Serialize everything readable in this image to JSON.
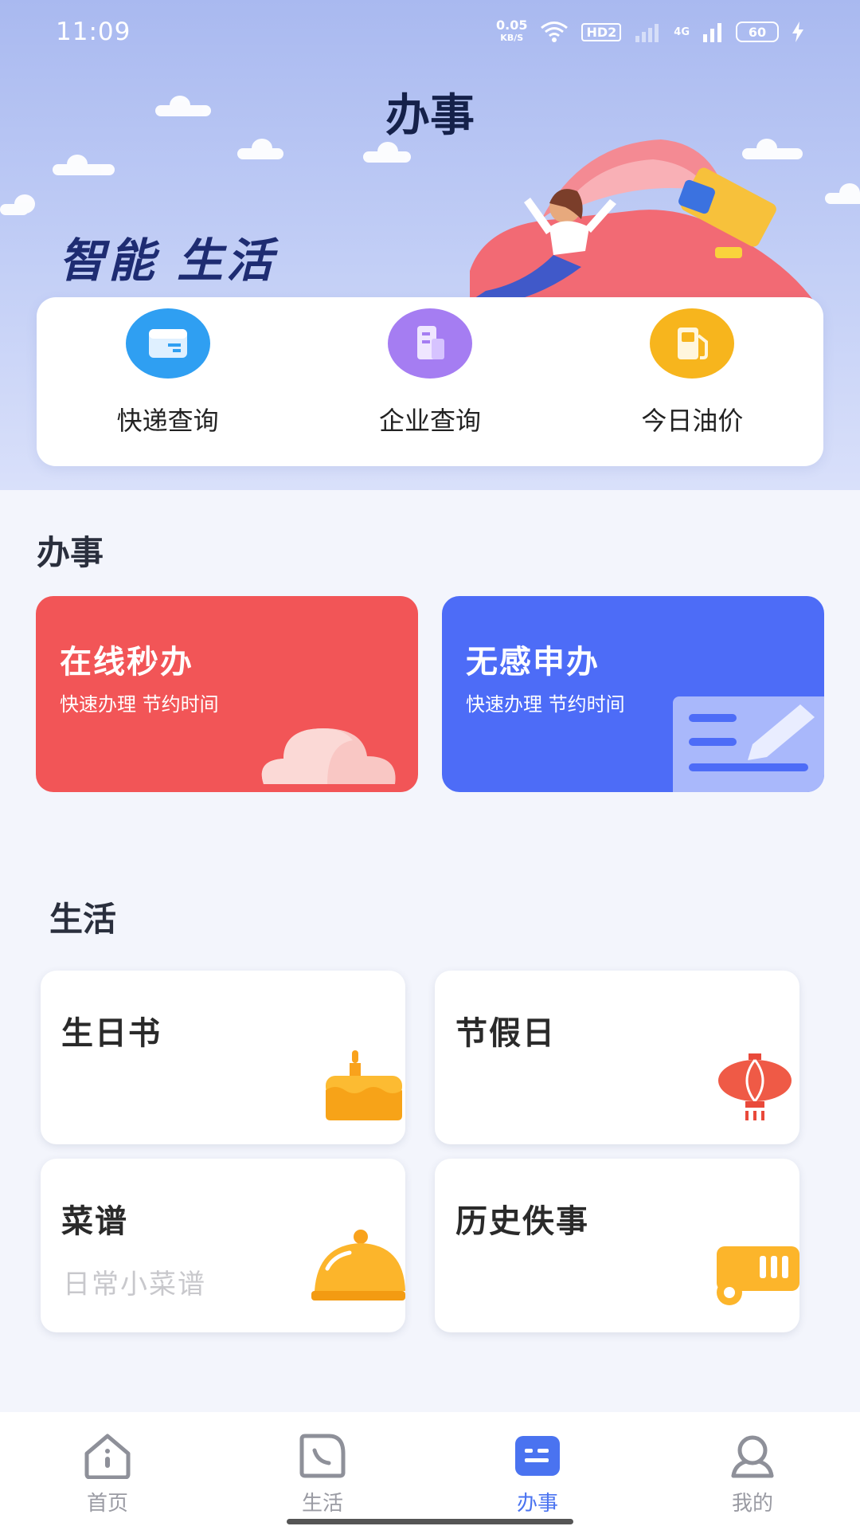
{
  "status_bar": {
    "time": "11:09",
    "net_speed": "0.05",
    "net_unit": "KB/S",
    "hd": "HD2",
    "network": "4G",
    "battery": "60"
  },
  "header": {
    "title": "办事",
    "slogan": "智能 生活"
  },
  "quick_actions": [
    {
      "label": "快递查询",
      "icon": "package-icon",
      "color": "#2f9ff2"
    },
    {
      "label": "企业查询",
      "icon": "building-icon",
      "color": "#a57df2"
    },
    {
      "label": "今日油价",
      "icon": "fuel-pump-icon",
      "color": "#f7b51d"
    }
  ],
  "section_office": {
    "title": "办事",
    "cards": [
      {
        "title": "在线秒办",
        "subtitle": "快速办理 节约时间",
        "color": "#f25557"
      },
      {
        "title": "无感申办",
        "subtitle": "快速办理 节约时间",
        "color": "#4d6cf7"
      }
    ]
  },
  "section_life": {
    "title": "生活",
    "cards": [
      {
        "title": "生日书",
        "subtitle": "",
        "icon": "cake-icon"
      },
      {
        "title": "节假日",
        "subtitle": "",
        "icon": "lantern-icon"
      },
      {
        "title": "菜谱",
        "subtitle": "日常小菜谱",
        "icon": "food-cover-icon"
      },
      {
        "title": "历史佚事",
        "subtitle": "",
        "icon": "film-reel-icon"
      }
    ]
  },
  "bottom_nav": {
    "items": [
      {
        "label": "首页",
        "icon": "home-icon"
      },
      {
        "label": "生活",
        "icon": "life-icon"
      },
      {
        "label": "办事",
        "icon": "office-icon",
        "active": true
      },
      {
        "label": "我的",
        "icon": "profile-icon"
      }
    ]
  }
}
